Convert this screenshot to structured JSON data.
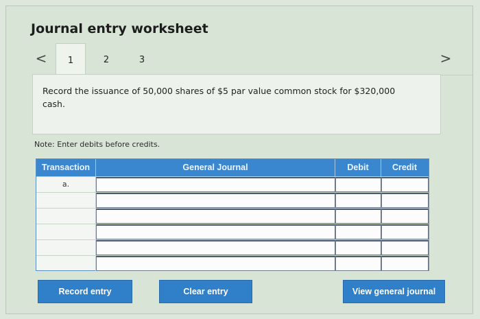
{
  "worksheet": {
    "title": "Journal entry worksheet"
  },
  "nav": {
    "prev_icon": "<",
    "next_icon": ">",
    "tabs": [
      {
        "label": "1"
      },
      {
        "label": "2"
      },
      {
        "label": "3"
      }
    ]
  },
  "prompt": {
    "text": "Record the issuance of 50,000 shares of $5 par value common stock for $320,000 cash."
  },
  "note": {
    "text": "Note: Enter debits before credits."
  },
  "journal": {
    "columns": {
      "transaction": "Transaction",
      "general_journal": "General Journal",
      "debit": "Debit",
      "credit": "Credit"
    },
    "rows": [
      {
        "transaction": "a."
      },
      {
        "transaction": ""
      },
      {
        "transaction": ""
      },
      {
        "transaction": ""
      },
      {
        "transaction": ""
      },
      {
        "transaction": ""
      }
    ]
  },
  "buttons": {
    "record": "Record entry",
    "clear": "Clear entry",
    "view": "View general journal"
  },
  "colors": {
    "accent": "#3a86cf",
    "background": "#dde7dc"
  }
}
